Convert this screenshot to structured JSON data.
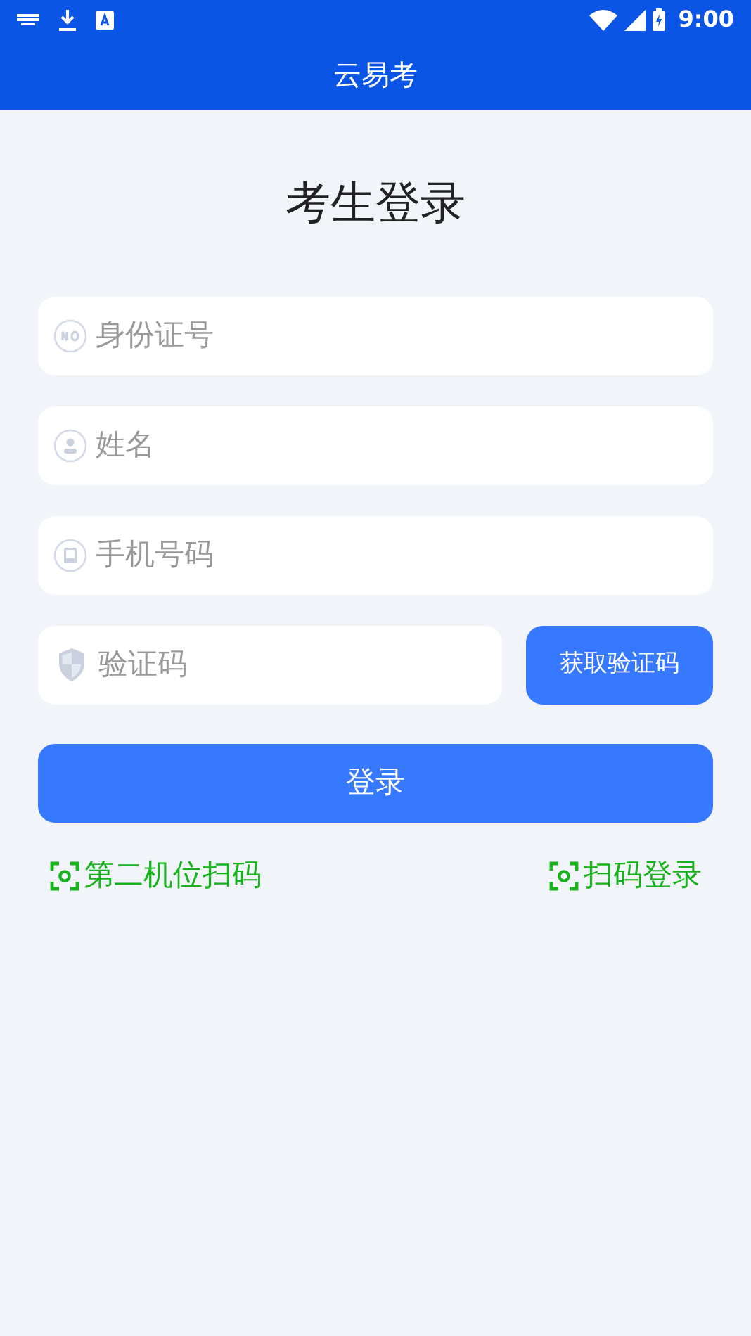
{
  "status_bar": {
    "time": "9:00"
  },
  "app_bar": {
    "title": "云易考"
  },
  "heading": "考生登录",
  "fields": [
    {
      "kind": "id",
      "placeholder": "身份证号"
    },
    {
      "kind": "person",
      "placeholder": "姓名"
    },
    {
      "kind": "phone",
      "placeholder": "手机号码"
    }
  ],
  "code_field": {
    "placeholder": "验证码"
  },
  "code_button": "获取验证码",
  "login_button": "登录",
  "links": [
    {
      "label": "第二机位扫码"
    },
    {
      "label": "扫码登录"
    }
  ]
}
